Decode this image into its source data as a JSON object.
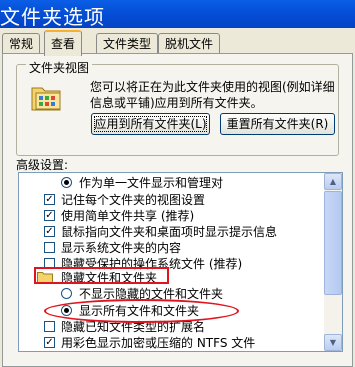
{
  "window": {
    "title": "文件夹选项"
  },
  "tabs": [
    {
      "label": "常规"
    },
    {
      "label": "查看"
    },
    {
      "label": "文件类型"
    },
    {
      "label": "脱机文件"
    }
  ],
  "folder_views": {
    "legend": "文件夹视图",
    "description": "您可以将正在为此文件夹使用的视图(例如详细信息或平铺)应用到所有文件夹。",
    "apply_button": "应用到所有文件夹(L)",
    "reset_button": "重置所有文件夹(R)"
  },
  "advanced": {
    "label": "高级设置:",
    "items": [
      {
        "type": "radio",
        "checked": true,
        "text": "作为单一文件显示和管理对"
      },
      {
        "type": "check",
        "checked": true,
        "text": "记住每个文件夹的视图设置"
      },
      {
        "type": "check",
        "checked": true,
        "text": "使用简单文件共享 (推荐)"
      },
      {
        "type": "check",
        "checked": true,
        "text": "鼠标指向文件夹和桌面项时显示提示信息"
      },
      {
        "type": "check",
        "checked": false,
        "text": "显示系统文件夹的内容"
      },
      {
        "type": "check",
        "checked": false,
        "text": "隐藏受保护的操作系统文件 (推荐)"
      },
      {
        "type": "folder",
        "checked": false,
        "text": "隐藏文件和文件夹"
      },
      {
        "type": "radio",
        "checked": false,
        "text": "不显示隐藏的文件和文件夹"
      },
      {
        "type": "radio",
        "checked": true,
        "text": "显示所有文件和文件夹"
      },
      {
        "type": "check",
        "checked": false,
        "text": "隐藏已知文件类型的扩展名"
      },
      {
        "type": "check",
        "checked": true,
        "text": "用彩色显示加密或压缩的 NTFS 文件"
      }
    ]
  }
}
